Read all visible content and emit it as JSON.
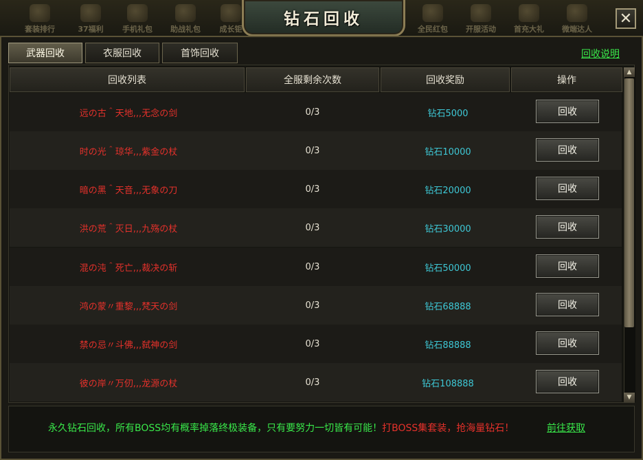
{
  "window": {
    "title": "钻石回收",
    "close_glyph": "✕"
  },
  "top_menu": [
    {
      "label": "套装排行",
      "icon": "ranking-icon"
    },
    {
      "label": "37福利",
      "icon": "gift-icon"
    },
    {
      "label": "手机礼包",
      "icon": "phone-gift-icon"
    },
    {
      "label": "助战礼包",
      "icon": "helper-gift-icon"
    },
    {
      "label": "成长钜",
      "icon": "growth-icon"
    },
    {
      "label": "全民红包",
      "icon": "red-packet-icon"
    },
    {
      "label": "开服活动",
      "icon": "event-icon"
    },
    {
      "label": "首充大礼",
      "icon": "first-charge-icon"
    },
    {
      "label": "微端达人",
      "icon": "client-icon"
    }
  ],
  "tabs": [
    {
      "label": "武器回收",
      "active": true
    },
    {
      "label": "衣服回收",
      "active": false
    },
    {
      "label": "首饰回收",
      "active": false
    }
  ],
  "help_link": "回收说明",
  "table": {
    "headers": [
      "回收列表",
      "全服剩余次数",
      "回收奖励",
      "操作"
    ],
    "button_label": "回收",
    "rows": [
      {
        "name": "远の古＾天地,,,无念の剑",
        "count": "0/3",
        "reward": "钻石5000"
      },
      {
        "name": "时の光＾琼华,,,紫金の杖",
        "count": "0/3",
        "reward": "钻石10000"
      },
      {
        "name": "暗の黑＾天音,,,无象の刀",
        "count": "0/3",
        "reward": "钻石20000"
      },
      {
        "name": "洪の荒＾灭日,,,九殇の杖",
        "count": "0/3",
        "reward": "钻石30000"
      },
      {
        "name": "混の沌＾死亡,,,裁决の斩",
        "count": "0/3",
        "reward": "钻石50000"
      },
      {
        "name": "鸿の蒙〃重黎,,,梵天の剑",
        "count": "0/3",
        "reward": "钻石68888"
      },
      {
        "name": "禁の忌〃斗佛,,,弑神の剑",
        "count": "0/3",
        "reward": "钻石88888"
      },
      {
        "name": "彼の岸〃万仞,,,龙源の杖",
        "count": "0/3",
        "reward": "钻石108888"
      }
    ]
  },
  "footer": {
    "text_green": "永久钻石回收，所有BOSS均有概率掉落终极装备，只有要努力一切皆有可能！",
    "text_red": "打BOSS集套装，抢海量钻石！",
    "link": "前往获取"
  },
  "colors": {
    "item_name": "#e5312b",
    "reward": "#3ec8d6",
    "link": "#39e84a"
  }
}
